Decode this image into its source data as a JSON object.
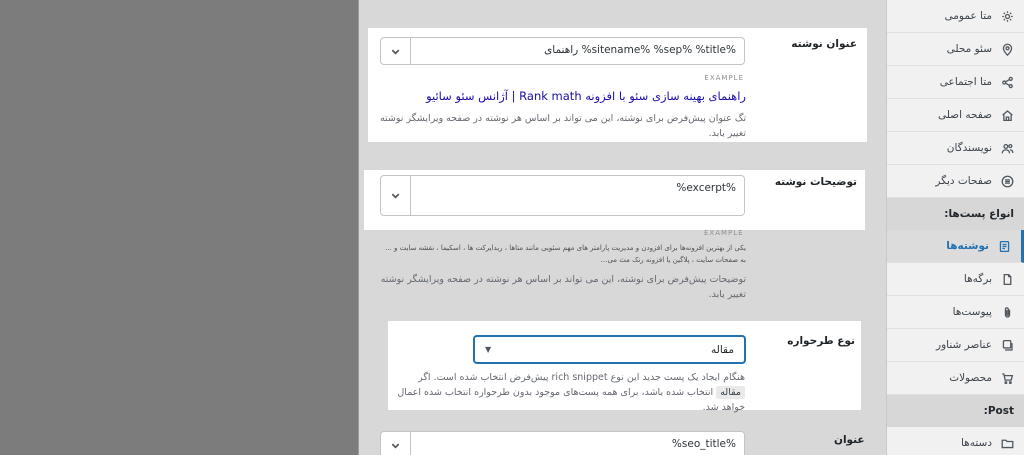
{
  "sidebar": {
    "items_top": [
      {
        "label": "متا عمومی",
        "icon": "gear-icon"
      },
      {
        "label": "سئو محلی",
        "icon": "location-pin-icon"
      },
      {
        "label": "متا اجتماعی",
        "icon": "share-icon"
      },
      {
        "label": "صفحه اصلی",
        "icon": "home-icon"
      },
      {
        "label": "نویسندگان",
        "icon": "users-icon"
      },
      {
        "label": "صفحات دیگر",
        "icon": "list-circle-icon"
      }
    ],
    "section_post_types": "انواع پست‌ها:",
    "items_post_types": [
      {
        "label": "نوشته‌ها",
        "icon": "document-icon"
      },
      {
        "label": "برگه‌ها",
        "icon": "page-icon"
      },
      {
        "label": "پیوست‌ها",
        "icon": "paperclip-icon"
      },
      {
        "label": "عناصر شناور",
        "icon": "layers-icon"
      },
      {
        "label": "محصولات",
        "icon": "cart-icon"
      }
    ],
    "section_post": "Post:",
    "items_post": [
      {
        "label": "دسته‌ها",
        "icon": "folder-icon"
      }
    ]
  },
  "post_title": {
    "label": "عنوان نوشته",
    "value": "راهنمای %sitename% %sep% %title%",
    "example_tag": "EXAMPLE",
    "example_title": "راهنمای بهینه سازی سئو با افزونه Rank math | آژانس سئو سائیو",
    "description": "تگ عنوان پیش‌فرض برای نوشته، این می تواند بر اساس هر نوشته در صفحه ویرایشگر نوشته تغییر یابد."
  },
  "post_description": {
    "label": "توضیحات نوشته",
    "value": "%excerpt%",
    "example_tag": "EXAMPLE",
    "preview_line1": "یکی از بهترین افزونه‌ها برای افزودن و مدیریت پارامتر های مهم سئویی مانند متاها ، ریدایرکت ها ، اسکیما ، نقشه سایت و ...",
    "preview_line2": "به صفحات سایت ، پلاگین یا افزونه رنک مث می...",
    "description": "توضیحات پیش‌فرض برای نوشته، این می تواند بر اساس هر نوشته در صفحه ویرایشگر نوشته تغییر یابد."
  },
  "schema_type": {
    "label": "نوع طرحواره",
    "selected": "مقاله",
    "desc_part1": "هنگام ایجاد یک پست جدید این نوع rich snippet پیش‌فرض انتخاب شده است. اگر",
    "desc_kbd": "مقاله",
    "desc_part2": "انتخاب شده باشد، برای همه پست‌های موجود بدون طرحواره انتخاب شده اعمال خواهد شد."
  },
  "seo_title": {
    "label": "عنوان",
    "value": "%seo_title%"
  }
}
